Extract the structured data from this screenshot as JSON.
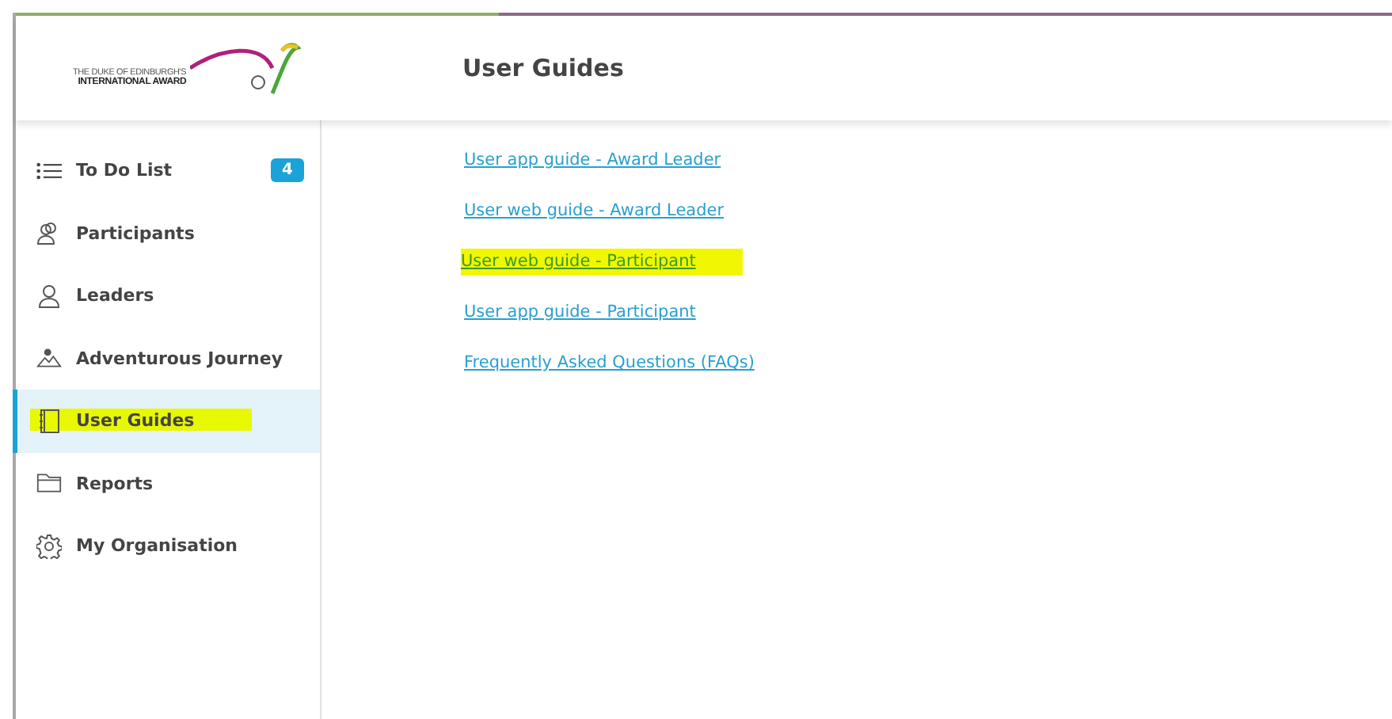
{
  "logo": {
    "lines": [
      "THE DUKE OF EDINBURGH'S",
      "INTERNATIONAL AWARD"
    ]
  },
  "page_title": "User Guides",
  "sidebar": {
    "items": [
      {
        "label": "To Do List",
        "badge": "4",
        "selected": false,
        "highlighted": false
      },
      {
        "label": "Participants",
        "selected": false,
        "highlighted": false
      },
      {
        "label": "Leaders",
        "selected": false,
        "highlighted": false
      },
      {
        "label": "Adventurous Journey",
        "selected": false,
        "highlighted": false
      },
      {
        "label": "User Guides",
        "selected": true,
        "highlighted": true
      },
      {
        "label": "Reports",
        "selected": false,
        "highlighted": false
      },
      {
        "label": "My Organisation",
        "selected": false,
        "highlighted": false
      }
    ]
  },
  "links": [
    {
      "label": "User app guide - Award Leader",
      "highlighted": false
    },
    {
      "label": "User web guide - Award Leader",
      "highlighted": false
    },
    {
      "label": "User web guide - Participant",
      "highlighted": true
    },
    {
      "label": "User app guide - Participant",
      "highlighted": false
    },
    {
      "label": "Frequently Asked Questions (FAQs)",
      "highlighted": false
    }
  ]
}
